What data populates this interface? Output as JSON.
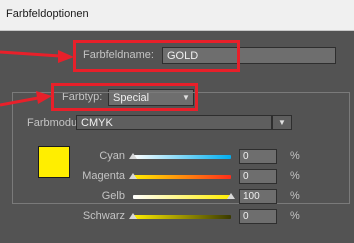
{
  "window": {
    "title": "Farbfeldoptionen"
  },
  "name_field": {
    "label": "Farbfeldname:",
    "value": "GOLD"
  },
  "type_field": {
    "label": "Farbtyp:",
    "value": "Special"
  },
  "mode_field": {
    "label": "Farbmodus:",
    "value": "CMYK"
  },
  "swatch_color": "#ffee00",
  "annotation_color": "#e8202a",
  "sliders": [
    {
      "label": "Cyan",
      "value": "0",
      "unit": "%",
      "level": 0
    },
    {
      "label": "Magenta",
      "value": "0",
      "unit": "%",
      "level": 0
    },
    {
      "label": "Gelb",
      "value": "100",
      "unit": "%",
      "level": 100
    },
    {
      "label": "Schwarz",
      "value": "0",
      "unit": "%",
      "level": 0
    }
  ]
}
